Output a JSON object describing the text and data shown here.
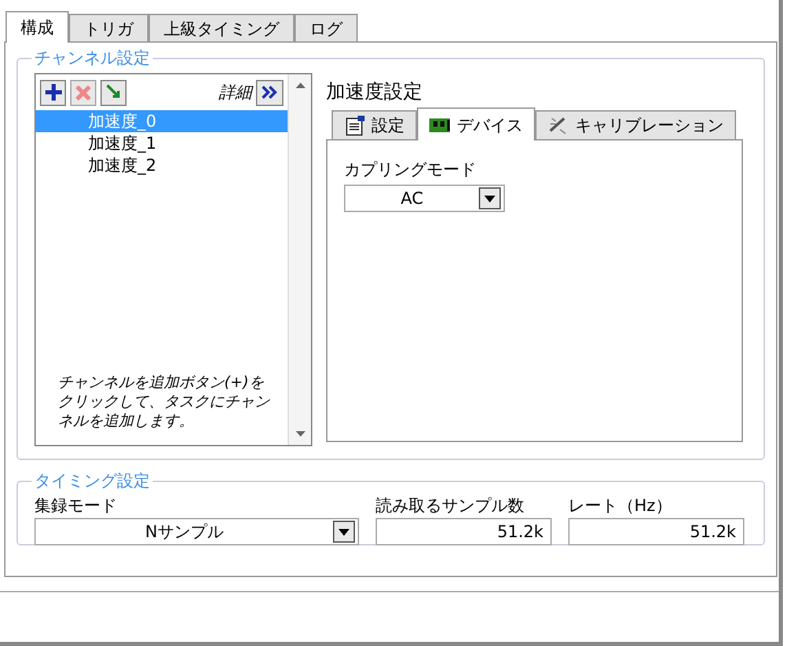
{
  "tabs": [
    {
      "label": "構成",
      "selected": true
    },
    {
      "label": "トリガ",
      "selected": false
    },
    {
      "label": "上級タイミング",
      "selected": false
    },
    {
      "label": "ログ",
      "selected": false
    }
  ],
  "channel_settings": {
    "title": "チャンネル設定",
    "details_label": "詳細",
    "channels": [
      {
        "name": "加速度_0",
        "selected": true
      },
      {
        "name": "加速度_1",
        "selected": false
      },
      {
        "name": "加速度_2",
        "selected": false
      }
    ],
    "hint": "チャンネルを追加ボタン(+)をクリックして、タスクにチャンネルを追加します。"
  },
  "channel_detail": {
    "title": "加速度設定",
    "tabs": [
      {
        "label": "設定",
        "selected": false
      },
      {
        "label": "デバイス",
        "selected": true
      },
      {
        "label": "キャリブレーション",
        "selected": false
      }
    ],
    "coupling": {
      "label": "カプリングモード",
      "value": "AC"
    }
  },
  "timing": {
    "title": "タイミング設定",
    "fields": [
      {
        "kind": "dropdown",
        "label": "集録モード",
        "value": "Nサンプル"
      },
      {
        "kind": "number",
        "label": "読み取るサンプル数",
        "value": "51.2k"
      },
      {
        "kind": "number",
        "label": "レート（Hz）",
        "value": "51.2k"
      }
    ]
  }
}
